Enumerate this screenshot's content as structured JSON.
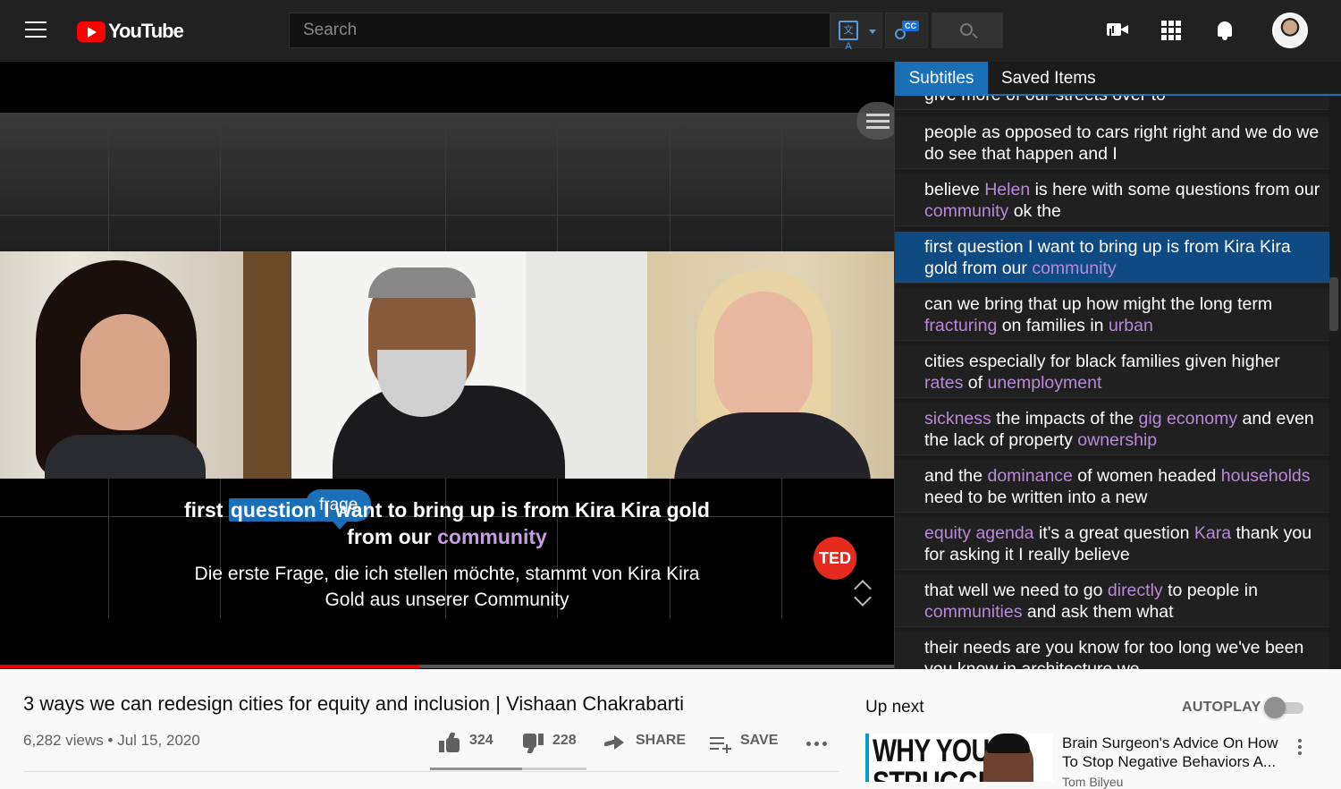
{
  "header": {
    "logo_text": "YouTube",
    "search_placeholder": "Search",
    "icons": [
      "menu-icon",
      "translate-icon",
      "caption-search-icon",
      "search-icon",
      "create-video-icon",
      "apps-icon",
      "notifications-icon",
      "avatar"
    ]
  },
  "player": {
    "word_tooltip": "frage",
    "caption_en": {
      "before": "first ",
      "highlight": "question",
      "after": " I want to bring up is from Kira Kira gold from our ",
      "keyword": "community"
    },
    "caption_de": "Die erste Frage, die ich stellen möchte, stammt von Kira Kira Gold aus unserer Community",
    "ted_badge": "TED",
    "progress_fraction": 0.469
  },
  "panel": {
    "tabs": [
      "Subtitles",
      "Saved Items"
    ],
    "partial_top": "give more of our streets over to",
    "items": [
      [
        {
          "t": "people as opposed to cars right right and we do we do see that happen and I"
        }
      ],
      [
        {
          "t": "believe "
        },
        {
          "t": "Helen",
          "k": 1
        },
        {
          "t": " is here with some questions from our "
        },
        {
          "t": "community",
          "k": 1
        },
        {
          "t": " ok the"
        }
      ],
      [
        {
          "t": "first question I want to bring up is from Kira Kira gold from our "
        },
        {
          "t": "community",
          "k": 1
        }
      ],
      [
        {
          "t": "can we bring that up how might the long term "
        },
        {
          "t": "fracturing",
          "k": 1
        },
        {
          "t": " on families in "
        },
        {
          "t": "urban",
          "k": 1
        }
      ],
      [
        {
          "t": "cities especially for black families given higher "
        },
        {
          "t": "rates",
          "k": 1
        },
        {
          "t": " of "
        },
        {
          "t": "unemployment",
          "k": 1
        }
      ],
      [
        {
          "t": "sickness",
          "k": 1
        },
        {
          "t": " the impacts of the "
        },
        {
          "t": "gig",
          "k": 1
        },
        {
          "t": " "
        },
        {
          "t": "economy",
          "k": 1
        },
        {
          "t": " and even the lack of property "
        },
        {
          "t": "ownership",
          "k": 1
        }
      ],
      [
        {
          "t": "and the "
        },
        {
          "t": "dominance",
          "k": 1
        },
        {
          "t": " of women headed "
        },
        {
          "t": "households",
          "k": 1
        },
        {
          "t": " need to be written into a new"
        }
      ],
      [
        {
          "t": "equity agenda",
          "k": 1
        },
        {
          "t": " it's a great question "
        },
        {
          "t": "Kara",
          "k": 1
        },
        {
          "t": " thank you for asking it I really believe"
        }
      ],
      [
        {
          "t": "that well we need to go "
        },
        {
          "t": "directly",
          "k": 1
        },
        {
          "t": " to people in "
        },
        {
          "t": "communities",
          "k": 1
        },
        {
          "t": " and ask them what"
        }
      ],
      [
        {
          "t": "their needs are you know for too long we've been you know in architecture we"
        }
      ]
    ],
    "active_index": 2
  },
  "video_info": {
    "title": "3 ways we can redesign cities for equity and inclusion | Vishaan Chakrabarti",
    "views": "6,282 views",
    "date": "Jul 15, 2020",
    "likes": "324",
    "dislikes": "228",
    "share_label": "SHARE",
    "save_label": "SAVE",
    "like_fraction": 0.587
  },
  "sidebar": {
    "up_next_label": "Up next",
    "autoplay_label": "AUTOPLAY",
    "autoplay_on": false,
    "rec_title": "Brain Surgeon's Advice On How To Stop Negative Behaviors A...",
    "rec_channel": "Tom Bilyeu",
    "thumb_text": "WHY YOU STRUGGLE"
  }
}
